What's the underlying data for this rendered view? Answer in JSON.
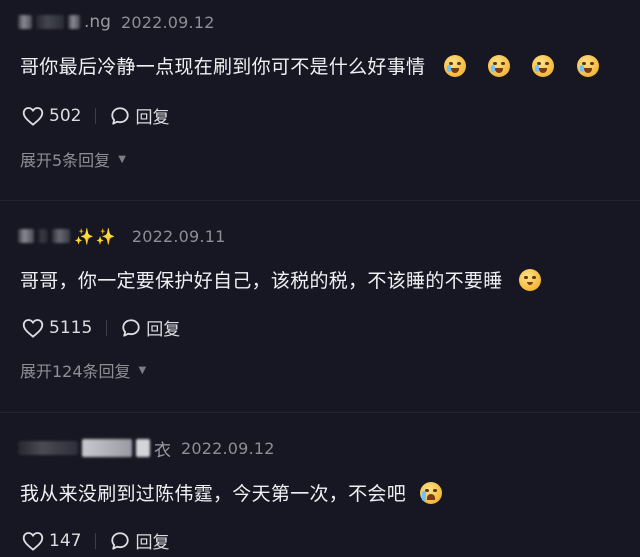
{
  "comments": [
    {
      "username_visible": ".ng",
      "date": "2022.09.12",
      "text": "哥你最后冷静一点现在刷到你可不是什么好事情",
      "likes": "502",
      "reply_label": "回复",
      "expand_label": "展开5条回复"
    },
    {
      "username_visible": "",
      "date": "2022.09.11",
      "text": "哥哥，你一定要保护好自己，该税的税，不该睡的不要睡",
      "likes": "5115",
      "reply_label": "回复",
      "expand_label": "展开124条回复"
    },
    {
      "username_visible": "衣",
      "date": "2022.09.12",
      "text": "我从来没刷到过陈伟霆，今天第一次，不会吧",
      "likes": "147",
      "reply_label": "回复"
    }
  ]
}
